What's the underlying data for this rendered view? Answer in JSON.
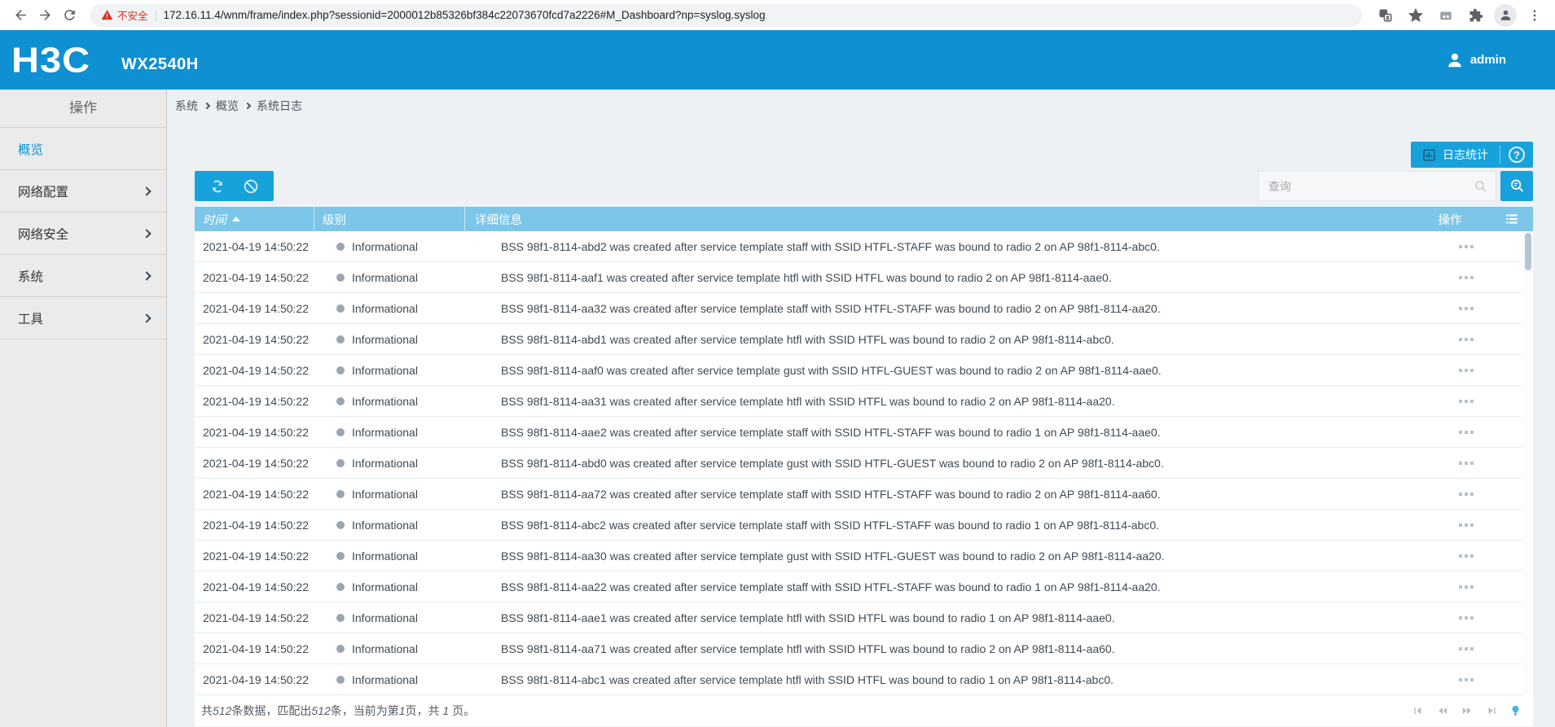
{
  "browser": {
    "security_warning": "不安全",
    "url": "172.16.11.4/wnm/frame/index.php?sessionid=2000012b85326bf384c22073670fcd7a2226#M_Dashboard?np=syslog.syslog",
    "icons": [
      "back-icon",
      "forward-icon",
      "reload-icon",
      "warning-triangle-icon",
      "translate-icon",
      "star-icon",
      "cards-icon",
      "extensions-puzzle-icon",
      "profile-avatar-icon",
      "kebab-menu-icon"
    ]
  },
  "header": {
    "brand": "H3C",
    "model": "WX2540H",
    "user": "admin",
    "accent_color": "#0e90d2"
  },
  "sidebar": {
    "title": "操作",
    "items": [
      {
        "label": "概览",
        "active": true,
        "has_children": false
      },
      {
        "label": "网络配置",
        "active": false,
        "has_children": true
      },
      {
        "label": "网络安全",
        "active": false,
        "has_children": true
      },
      {
        "label": "系统",
        "active": false,
        "has_children": true
      },
      {
        "label": "工具",
        "active": false,
        "has_children": true
      }
    ]
  },
  "breadcrumb": {
    "parts": [
      "系统",
      "概览",
      "系统日志"
    ],
    "separator_icon": "chevron-right"
  },
  "actions": {
    "log_stats_label": "日志统计",
    "log_stats_icon": "bar-chart-icon",
    "help_glyph": "?",
    "button_color": "#17a2dc"
  },
  "toolbar": {
    "icons": [
      "refresh-icon",
      "clear-ban-icon"
    ]
  },
  "search": {
    "placeholder": "查询",
    "input_icon": "search-icon",
    "button_icon": "advanced-search-icon"
  },
  "table": {
    "header_color": "#7cc6e9",
    "headers": {
      "time": "时间",
      "level": "级别",
      "detail": "详细信息",
      "action": "操作"
    },
    "sort": {
      "column": "时间",
      "direction": "asc"
    },
    "level_dot_color": "#9aa6b2",
    "rows": [
      {
        "time": "2021-04-19 14:50:22",
        "level": "Informational",
        "detail": "BSS 98f1-8114-abd2 was created after service template staff with SSID HTFL-STAFF was bound to radio 2 on AP 98f1-8114-abc0."
      },
      {
        "time": "2021-04-19 14:50:22",
        "level": "Informational",
        "detail": "BSS 98f1-8114-aaf1 was created after service template htfl with SSID HTFL was bound to radio 2 on AP 98f1-8114-aae0."
      },
      {
        "time": "2021-04-19 14:50:22",
        "level": "Informational",
        "detail": "BSS 98f1-8114-aa32 was created after service template staff with SSID HTFL-STAFF was bound to radio 2 on AP 98f1-8114-aa20."
      },
      {
        "time": "2021-04-19 14:50:22",
        "level": "Informational",
        "detail": "BSS 98f1-8114-abd1 was created after service template htfl with SSID HTFL was bound to radio 2 on AP 98f1-8114-abc0."
      },
      {
        "time": "2021-04-19 14:50:22",
        "level": "Informational",
        "detail": "BSS 98f1-8114-aaf0 was created after service template gust with SSID HTFL-GUEST was bound to radio 2 on AP 98f1-8114-aae0."
      },
      {
        "time": "2021-04-19 14:50:22",
        "level": "Informational",
        "detail": "BSS 98f1-8114-aa31 was created after service template htfl with SSID HTFL was bound to radio 2 on AP 98f1-8114-aa20."
      },
      {
        "time": "2021-04-19 14:50:22",
        "level": "Informational",
        "detail": "BSS 98f1-8114-aae2 was created after service template staff with SSID HTFL-STAFF was bound to radio 1 on AP 98f1-8114-aae0."
      },
      {
        "time": "2021-04-19 14:50:22",
        "level": "Informational",
        "detail": "BSS 98f1-8114-abd0 was created after service template gust with SSID HTFL-GUEST was bound to radio 2 on AP 98f1-8114-abc0."
      },
      {
        "time": "2021-04-19 14:50:22",
        "level": "Informational",
        "detail": "BSS 98f1-8114-aa72 was created after service template staff with SSID HTFL-STAFF was bound to radio 2 on AP 98f1-8114-aa60."
      },
      {
        "time": "2021-04-19 14:50:22",
        "level": "Informational",
        "detail": "BSS 98f1-8114-abc2 was created after service template staff with SSID HTFL-STAFF was bound to radio 1 on AP 98f1-8114-abc0."
      },
      {
        "time": "2021-04-19 14:50:22",
        "level": "Informational",
        "detail": "BSS 98f1-8114-aa30 was created after service template gust with SSID HTFL-GUEST was bound to radio 2 on AP 98f1-8114-aa20."
      },
      {
        "time": "2021-04-19 14:50:22",
        "level": "Informational",
        "detail": "BSS 98f1-8114-aa22 was created after service template staff with SSID HTFL-STAFF was bound to radio 1 on AP 98f1-8114-aa20."
      },
      {
        "time": "2021-04-19 14:50:22",
        "level": "Informational",
        "detail": "BSS 98f1-8114-aae1 was created after service template htfl with SSID HTFL was bound to radio 1 on AP 98f1-8114-aae0."
      },
      {
        "time": "2021-04-19 14:50:22",
        "level": "Informational",
        "detail": "BSS 98f1-8114-aa71 was created after service template htfl with SSID HTFL was bound to radio 2 on AP 98f1-8114-aa60."
      },
      {
        "time": "2021-04-19 14:50:22",
        "level": "Informational",
        "detail": "BSS 98f1-8114-abc1 was created after service template htfl with SSID HTFL was bound to radio 1 on AP 98f1-8114-abc0."
      }
    ]
  },
  "footer": {
    "segments": [
      {
        "t": "共"
      },
      {
        "t": "512",
        "i": true
      },
      {
        "t": "条数据，匹配出"
      },
      {
        "t": "512",
        "i": true
      },
      {
        "t": "条，当前为第"
      },
      {
        "t": "1",
        "i": true
      },
      {
        "t": "页，共 "
      },
      {
        "t": "1",
        "i": true
      },
      {
        "t": " 页。"
      }
    ],
    "total": "512",
    "matched": "512",
    "current_page": "1",
    "total_pages": "1",
    "pager_icons": [
      "first-page-icon",
      "prev-page-icon",
      "next-page-icon",
      "last-page-icon",
      "lightbulb-icon"
    ]
  }
}
